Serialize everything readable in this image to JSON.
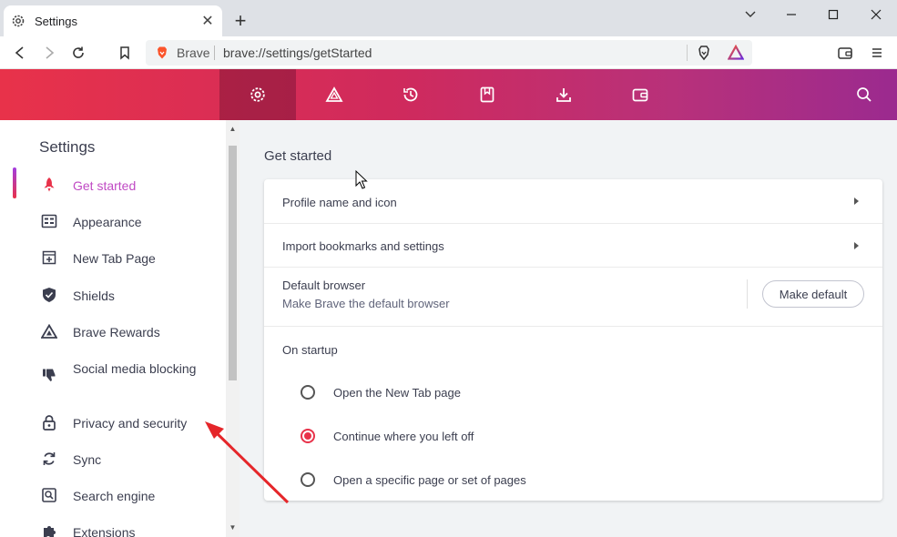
{
  "tab": {
    "title": "Settings",
    "close": "✕",
    "new": "+"
  },
  "window": {
    "minimize": "—",
    "maximize": "☐",
    "close": "✕"
  },
  "omnibox": {
    "label": "Brave",
    "url": "brave://settings/getStarted"
  },
  "header_icons": [
    "settings-icon",
    "rewards-icon",
    "history-icon",
    "bookmarks-icon",
    "downloads-icon",
    "wallet-icon",
    "search-icon"
  ],
  "sidebar": {
    "title": "Settings",
    "items": [
      {
        "label": "Get started",
        "icon": "rocket-icon",
        "active": true
      },
      {
        "label": "Appearance",
        "icon": "appearance-icon"
      },
      {
        "label": "New Tab Page",
        "icon": "new-tab-page-icon"
      },
      {
        "label": "Shields",
        "icon": "shield-icon"
      },
      {
        "label": "Brave Rewards",
        "icon": "rewards-icon"
      },
      {
        "label": "Social media blocking",
        "icon": "thumbs-down-icon"
      },
      {
        "label": "Privacy and security",
        "icon": "lock-icon"
      },
      {
        "label": "Sync",
        "icon": "sync-icon"
      },
      {
        "label": "Search engine",
        "icon": "search-engine-icon"
      },
      {
        "label": "Extensions",
        "icon": "puzzle-icon"
      }
    ]
  },
  "main": {
    "title": "Get started",
    "rows": {
      "profile": "Profile name and icon",
      "import": "Import bookmarks and settings",
      "default_browser": "Default browser",
      "default_browser_sub": "Make Brave the default browser",
      "make_default": "Make default",
      "startup": "On startup"
    },
    "startup_options": [
      {
        "label": "Open the New Tab page",
        "selected": false
      },
      {
        "label": "Continue where you left off",
        "selected": true
      },
      {
        "label": "Open a specific page or set of pages",
        "selected": false
      }
    ]
  },
  "colors": {
    "accent": "#e8324a",
    "active_nav": "#c04ac4",
    "arrow": "#e5262a"
  }
}
